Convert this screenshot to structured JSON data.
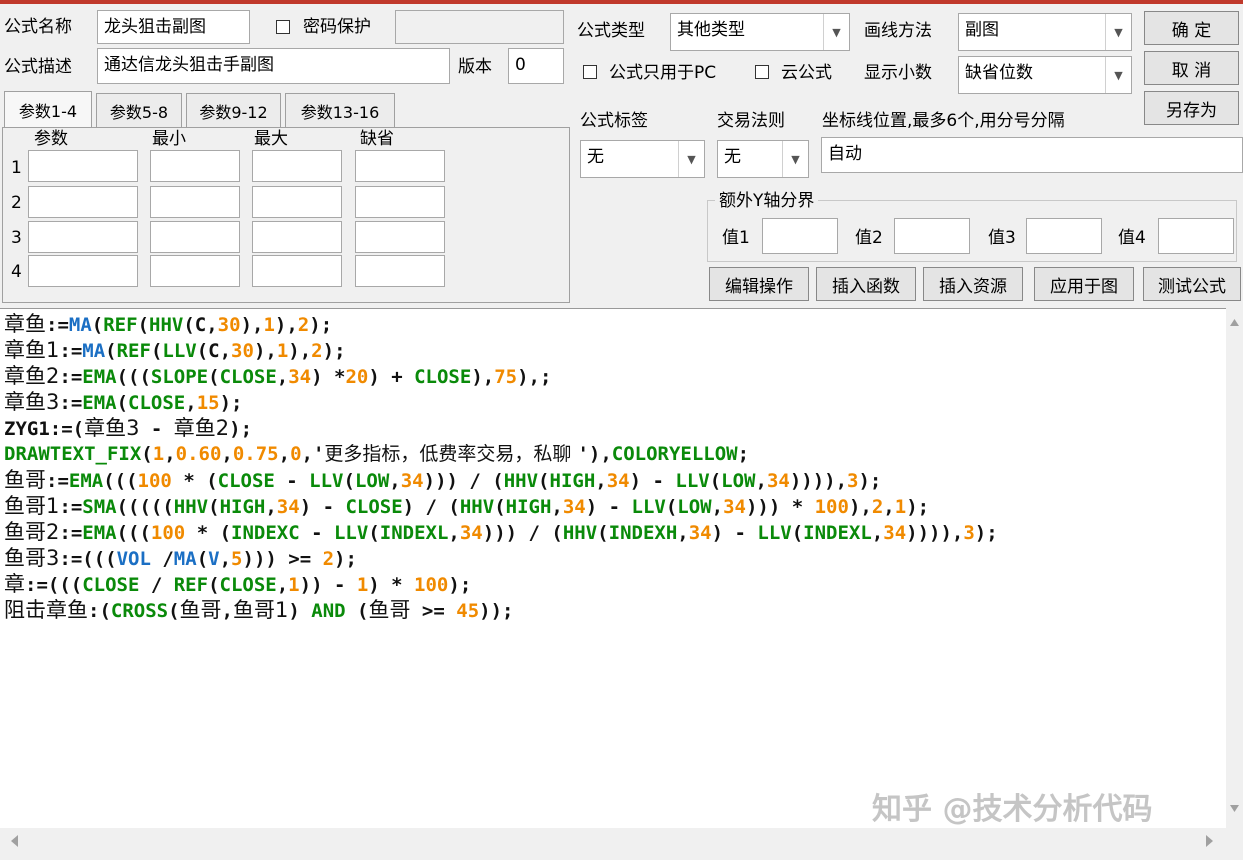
{
  "form": {
    "name_label": "公式名称",
    "name_value": "龙头狙击副图",
    "password_label": "密码保护",
    "password_value": "",
    "desc_label": "公式描述",
    "desc_value": "通达信龙头狙击手副图",
    "version_label": "版本",
    "version_value": "0",
    "type_label": "公式类型",
    "type_value": "其他类型",
    "draw_label": "画线方法",
    "draw_value": "副图",
    "pc_only_label": "公式只用于PC",
    "cloud_label": "云公式",
    "decimals_label": "显示小数",
    "decimals_value": "缺省位数",
    "tag_label": "公式标签",
    "tag_value": "无",
    "trade_label": "交易法则",
    "trade_value": "无",
    "axis_label": "坐标线位置,最多6个,用分号分隔",
    "axis_value": "自动"
  },
  "buttons": {
    "ok": "确  定",
    "cancel": "取  消",
    "save_as": "另存为",
    "edit": "编辑操作",
    "insert_fn": "插入函数",
    "insert_res": "插入资源",
    "apply": "应用于图",
    "test": "测试公式"
  },
  "tabs": [
    "参数1-4",
    "参数5-8",
    "参数9-12",
    "参数13-16"
  ],
  "params": {
    "headers": [
      "参数",
      "最小",
      "最大",
      "缺省"
    ],
    "rows": [
      "1",
      "2",
      "3",
      "4"
    ]
  },
  "yaxis": {
    "title": "额外Y轴分界",
    "labels": [
      "值1",
      "值2",
      "值3",
      "值4"
    ]
  },
  "code": [
    [
      [
        "p",
        "章鱼"
      ],
      [
        "s",
        ":="
      ],
      [
        "m",
        "MA"
      ],
      [
        "s",
        "("
      ],
      [
        "f",
        "REF"
      ],
      [
        "s",
        "("
      ],
      [
        "f",
        "HHV"
      ],
      [
        "s",
        "(C,"
      ],
      [
        "n",
        "30"
      ],
      [
        "s",
        "),"
      ],
      [
        "n",
        "1"
      ],
      [
        "s",
        "),"
      ],
      [
        "n",
        "2"
      ],
      [
        "s",
        ");"
      ]
    ],
    [
      [
        "p",
        "章鱼1"
      ],
      [
        "s",
        ":="
      ],
      [
        "m",
        "MA"
      ],
      [
        "s",
        "("
      ],
      [
        "f",
        "REF"
      ],
      [
        "s",
        "("
      ],
      [
        "f",
        "LLV"
      ],
      [
        "s",
        "(C,"
      ],
      [
        "n",
        "30"
      ],
      [
        "s",
        "),"
      ],
      [
        "n",
        "1"
      ],
      [
        "s",
        "),"
      ],
      [
        "n",
        "2"
      ],
      [
        "s",
        ");"
      ]
    ],
    [
      [
        "p",
        "章鱼2"
      ],
      [
        "s",
        ":="
      ],
      [
        "f",
        "EMA"
      ],
      [
        "s",
        "((("
      ],
      [
        "f",
        "SLOPE"
      ],
      [
        "s",
        "("
      ],
      [
        "f",
        "CLOSE"
      ],
      [
        "s",
        ","
      ],
      [
        "n",
        "34"
      ],
      [
        "s",
        ") *"
      ],
      [
        "n",
        "20"
      ],
      [
        "s",
        ") + "
      ],
      [
        "f",
        "CLOSE"
      ],
      [
        "s",
        "),"
      ],
      [
        "n",
        "75"
      ],
      [
        "s",
        "),;"
      ]
    ],
    [
      [
        "p",
        "章鱼3"
      ],
      [
        "s",
        ":="
      ],
      [
        "f",
        "EMA"
      ],
      [
        "s",
        "("
      ],
      [
        "f",
        "CLOSE"
      ],
      [
        "s",
        ","
      ],
      [
        "n",
        "15"
      ],
      [
        "s",
        ");"
      ]
    ],
    [
      [
        "s",
        "ZYG1:=("
      ],
      [
        "p",
        "章鱼3"
      ],
      [
        "s",
        " - "
      ],
      [
        "p",
        "章鱼2"
      ],
      [
        "s",
        ");"
      ]
    ],
    [
      [
        "f",
        "DRAWTEXT_FIX"
      ],
      [
        "s",
        "("
      ],
      [
        "n",
        "1"
      ],
      [
        "s",
        ","
      ],
      [
        "n",
        "0.60"
      ],
      [
        "s",
        ","
      ],
      [
        "n",
        "0.75"
      ],
      [
        "s",
        ","
      ],
      [
        "n",
        "0"
      ],
      [
        "s",
        ",'"
      ],
      [
        "t",
        "更多指标，低费率交易，私聊 "
      ],
      [
        "s",
        "'),"
      ],
      [
        "f",
        "COLORYELLOW"
      ],
      [
        "s",
        ";"
      ]
    ],
    [
      [
        "p",
        "鱼哥"
      ],
      [
        "s",
        ":="
      ],
      [
        "f",
        "EMA"
      ],
      [
        "s",
        "((("
      ],
      [
        "n",
        "100"
      ],
      [
        "s",
        " * ("
      ],
      [
        "f",
        "CLOSE"
      ],
      [
        "s",
        " - "
      ],
      [
        "f",
        "LLV"
      ],
      [
        "s",
        "("
      ],
      [
        "f",
        "LOW"
      ],
      [
        "s",
        ","
      ],
      [
        "n",
        "34"
      ],
      [
        "s",
        ")))"
      ],
      [
        "s",
        " / ("
      ],
      [
        "f",
        "HHV"
      ],
      [
        "s",
        "("
      ],
      [
        "f",
        "HIGH"
      ],
      [
        "s",
        ","
      ],
      [
        "n",
        "34"
      ],
      [
        "s",
        ") - "
      ],
      [
        "f",
        "LLV"
      ],
      [
        "s",
        "("
      ],
      [
        "f",
        "LOW"
      ],
      [
        "s",
        ","
      ],
      [
        "n",
        "34"
      ],
      [
        "s",
        ")))),"
      ],
      [
        "n",
        "3"
      ],
      [
        "s",
        ");"
      ]
    ],
    [
      [
        "p",
        "鱼哥1"
      ],
      [
        "s",
        ":="
      ],
      [
        "f",
        "SMA"
      ],
      [
        "s",
        "((((("
      ],
      [
        "f",
        "HHV"
      ],
      [
        "s",
        "("
      ],
      [
        "f",
        "HIGH"
      ],
      [
        "s",
        ","
      ],
      [
        "n",
        "34"
      ],
      [
        "s",
        ") - "
      ],
      [
        "f",
        "CLOSE"
      ],
      [
        "s",
        ") / ("
      ],
      [
        "f",
        "HHV"
      ],
      [
        "s",
        "("
      ],
      [
        "f",
        "HIGH"
      ],
      [
        "s",
        ","
      ],
      [
        "n",
        "34"
      ],
      [
        "s",
        ") - "
      ],
      [
        "f",
        "LLV"
      ],
      [
        "s",
        "("
      ],
      [
        "f",
        "LOW"
      ],
      [
        "s",
        ","
      ],
      [
        "n",
        "34"
      ],
      [
        "s",
        "))) * "
      ],
      [
        "n",
        "100"
      ],
      [
        "s",
        "),"
      ],
      [
        "n",
        "2"
      ],
      [
        "s",
        ","
      ],
      [
        "n",
        "1"
      ],
      [
        "s",
        ");"
      ]
    ],
    [
      [
        "p",
        "鱼哥2"
      ],
      [
        "s",
        ":="
      ],
      [
        "f",
        "EMA"
      ],
      [
        "s",
        "((("
      ],
      [
        "n",
        "100"
      ],
      [
        "s",
        " * ("
      ],
      [
        "f",
        "INDEXC"
      ],
      [
        "s",
        " - "
      ],
      [
        "f",
        "LLV"
      ],
      [
        "s",
        "("
      ],
      [
        "f",
        "INDEXL"
      ],
      [
        "s",
        ","
      ],
      [
        "n",
        "34"
      ],
      [
        "s",
        ")))"
      ],
      [
        "s",
        " / ("
      ],
      [
        "f",
        "HHV"
      ],
      [
        "s",
        "("
      ],
      [
        "f",
        "INDEXH"
      ],
      [
        "s",
        ","
      ],
      [
        "n",
        "34"
      ],
      [
        "s",
        ") - "
      ],
      [
        "f",
        "LLV"
      ],
      [
        "s",
        "("
      ],
      [
        "f",
        "INDEXL"
      ],
      [
        "s",
        ","
      ],
      [
        "n",
        "34"
      ],
      [
        "s",
        ")))),"
      ],
      [
        "n",
        "3"
      ],
      [
        "s",
        ");"
      ]
    ],
    [
      [
        "p",
        "鱼哥3"
      ],
      [
        "s",
        ":=((("
      ],
      [
        "m",
        "VOL"
      ],
      [
        "s",
        " /"
      ],
      [
        "m",
        "MA"
      ],
      [
        "s",
        "("
      ],
      [
        "m",
        "V"
      ],
      [
        "s",
        ","
      ],
      [
        "n",
        "5"
      ],
      [
        "s",
        ")))"
      ],
      [
        "s",
        " >= "
      ],
      [
        "n",
        "2"
      ],
      [
        "s",
        ");"
      ]
    ],
    [
      [
        "p",
        "章"
      ],
      [
        "s",
        ":=((("
      ],
      [
        "f",
        "CLOSE"
      ],
      [
        "s",
        " / "
      ],
      [
        "f",
        "REF"
      ],
      [
        "s",
        "("
      ],
      [
        "f",
        "CLOSE"
      ],
      [
        "s",
        ","
      ],
      [
        "n",
        "1"
      ],
      [
        "s",
        ")) - "
      ],
      [
        "n",
        "1"
      ],
      [
        "s",
        ") * "
      ],
      [
        "n",
        "100"
      ],
      [
        "s",
        ");"
      ]
    ],
    [
      [
        "p",
        "阻击章鱼"
      ],
      [
        "s",
        ":("
      ],
      [
        "f",
        "CROSS"
      ],
      [
        "s",
        "("
      ],
      [
        "p",
        "鱼哥"
      ],
      [
        "s",
        ","
      ],
      [
        "p",
        "鱼哥1"
      ],
      [
        "s",
        ") "
      ],
      [
        "f",
        "AND"
      ],
      [
        "s",
        " ("
      ],
      [
        "p",
        "鱼哥"
      ],
      [
        "s",
        " >= "
      ],
      [
        "n",
        "45"
      ],
      [
        "s",
        "));"
      ]
    ]
  ],
  "watermark": "知乎 @技术分析代码",
  "colors": {
    "fn": "#0a8a0a",
    "ma": "#1b6fc4",
    "num": "#f08a00",
    "accent": "#c0392b"
  }
}
